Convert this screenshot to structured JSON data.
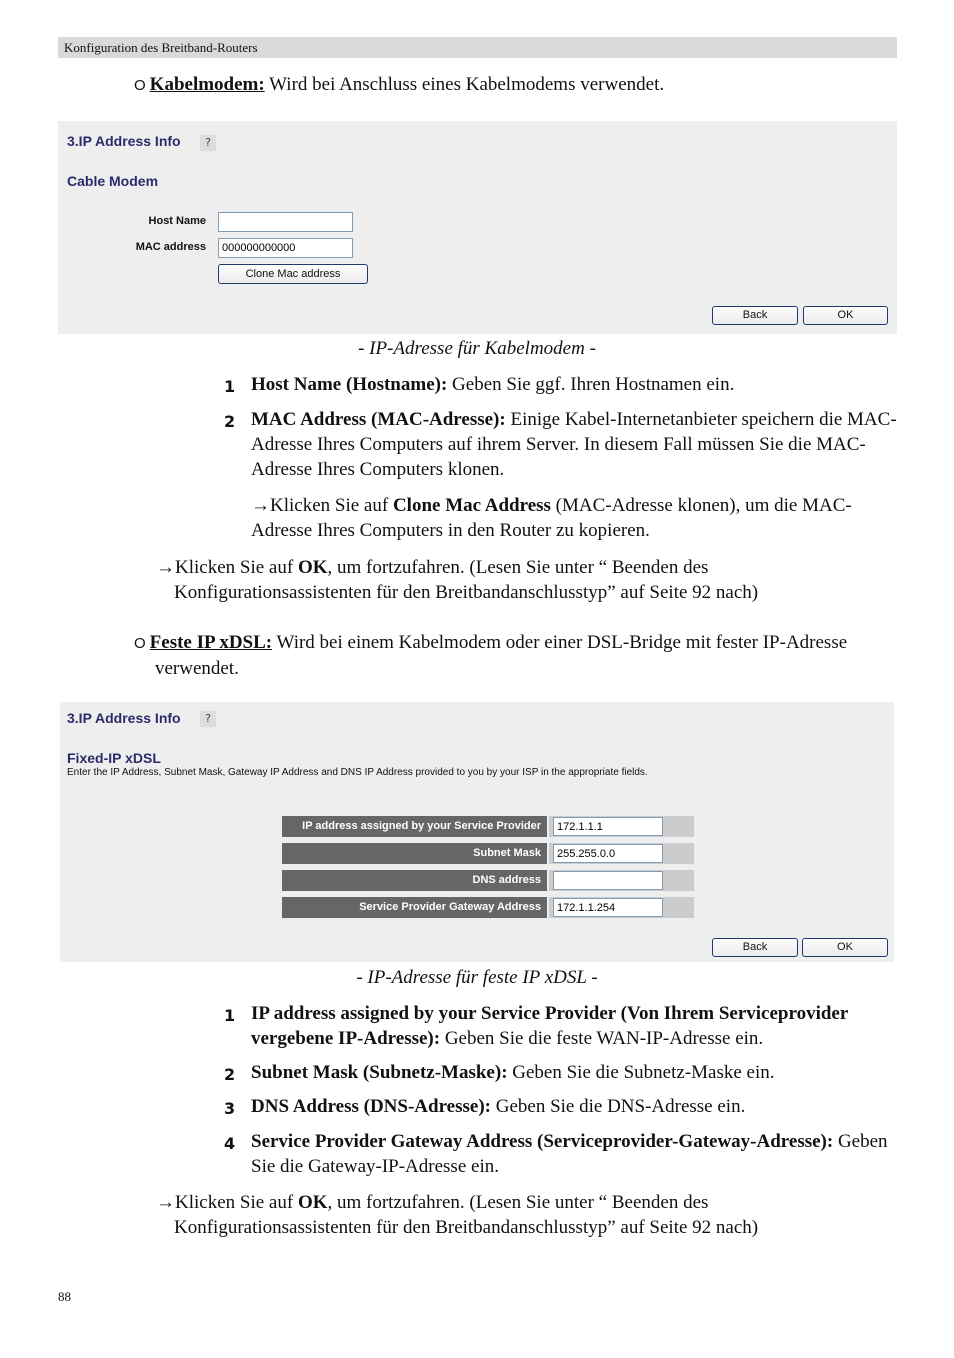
{
  "header": {
    "title": "Konfiguration des Breitband-Routers"
  },
  "section_cable": {
    "bullet": "O",
    "term": "Kabelmodem:",
    "text": " Wird bei Anschluss eines Kabelmodems verwendet."
  },
  "panel_cable": {
    "title": "3.IP Address Info",
    "help_icon": "help-icon",
    "subtitle": "Cable Modem",
    "host_name_label": "Host Name",
    "host_name_value": "",
    "mac_label": "MAC address",
    "mac_value": "000000000000",
    "clone_button": "Clone Mac address",
    "back_button": "Back",
    "ok_button": "OK"
  },
  "caption_cable": "- IP-Adresse für Kabelmodem -",
  "cable_steps": [
    {
      "num": "1",
      "term": "Host Name (Hostname):",
      "text": " Geben Sie ggf. Ihren Hostnamen ein."
    },
    {
      "num": "2",
      "term": "MAC Address (MAC-Adresse):",
      "text": " Einige Kabel-Internetanbieter speichern die MAC-Adresse Ihres Computers auf ihrem Server. In diesem Fall müssen Sie die MAC-Adresse Ihres Computers klonen."
    }
  ],
  "cable_clone_note": {
    "arrow": "→",
    "pre": "Klicken Sie auf ",
    "bold": "Clone Mac Address",
    "post": " (MAC-Adresse klonen), um die MAC-Adresse Ihres Computers in den Router zu kopieren."
  },
  "cable_ok_note": {
    "arrow": "→",
    "pre": "Klicken Sie auf ",
    "bold": "OK",
    "post": ", um fortzufahren. (Lesen Sie unter “ Beenden des Konfigurationsassistenten für den Breitbandanschlusstyp”  auf Seite  92 nach)"
  },
  "section_fixed": {
    "bullet": "O",
    "term": "Feste IP xDSL:",
    "text": " Wird bei einem Kabelmodem oder einer DSL-Bridge mit fester IP-Adresse verwendet."
  },
  "panel_fixed": {
    "title": "3.IP Address Info",
    "help_icon": "help-icon",
    "subtitle": "Fixed-IP xDSL",
    "description": "Enter the IP Address, Subnet Mask, Gateway IP Address and DNS IP Address provided to you by your ISP in the appropriate fields.",
    "fields": [
      {
        "label": "IP address assigned by your Service Provider",
        "value": "172.1.1.1"
      },
      {
        "label": "Subnet Mask",
        "value": "255.255.0.0"
      },
      {
        "label": "DNS address",
        "value": ""
      },
      {
        "label": "Service Provider Gateway Address",
        "value": "172.1.1.254"
      }
    ],
    "back_button": "Back",
    "ok_button": "OK"
  },
  "caption_fixed": "- IP-Adresse für feste IP xDSL -",
  "fixed_steps": [
    {
      "num": "1",
      "term": "IP address assigned by your Service Provider (Von Ihrem Serviceprovider vergebene IP-Adresse):",
      "text": " Geben Sie die feste WAN-IP-Adresse ein."
    },
    {
      "num": "2",
      "term": "Subnet Mask (Subnetz-Maske):",
      "text": " Geben Sie die Subnetz-Maske ein."
    },
    {
      "num": "3",
      "term": "DNS Address (DNS-Adresse):",
      "text": " Geben Sie die DNS-Adresse ein."
    },
    {
      "num": "4",
      "term": "Service Provider Gateway Address (Serviceprovider-Gateway-Adresse):",
      "text": " Geben Sie die Gateway-IP-Adresse ein."
    }
  ],
  "fixed_ok_note": {
    "arrow": "→",
    "pre": "Klicken Sie auf ",
    "bold": "OK",
    "post": ", um fortzufahren. (Lesen Sie unter “ Beenden des Konfigurationsassistenten für den Breitbandanschlusstyp”  auf Seite  92 nach)"
  },
  "page_number": "88"
}
